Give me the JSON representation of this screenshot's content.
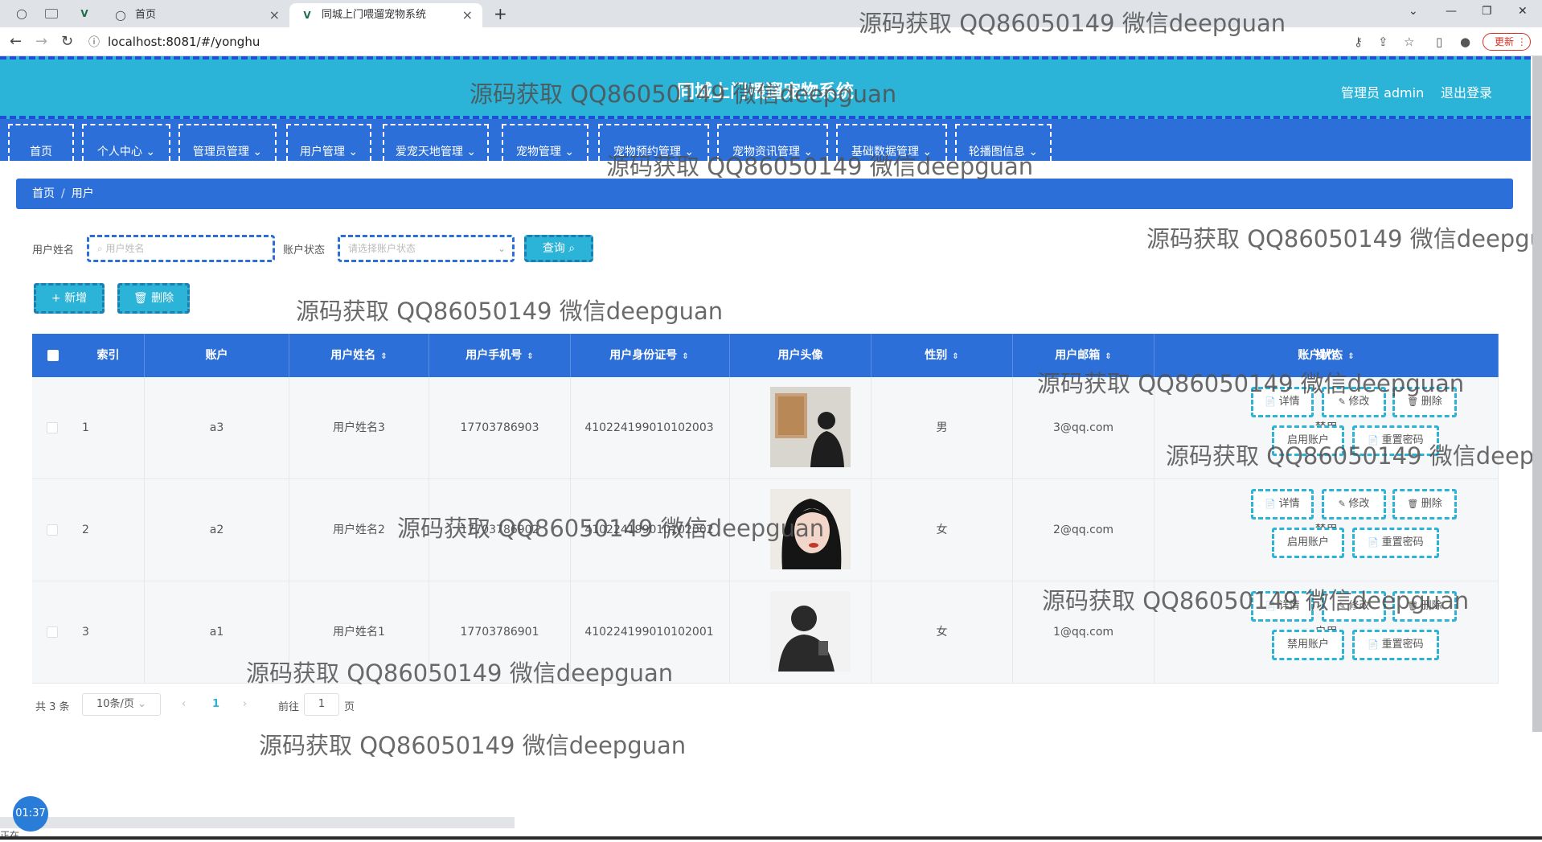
{
  "browser": {
    "tabs": [
      {
        "title": "首页",
        "icon": "globe-icon"
      },
      {
        "title": "同城上门喂遛宠物系统",
        "icon": "vue-icon"
      }
    ],
    "url": "localhost:8081/#/yonghu",
    "update_label": "更新"
  },
  "header": {
    "title": "同城上门喂遛宠物系统",
    "admin_label": "管理员 admin",
    "logout_label": "退出登录"
  },
  "menu": [
    {
      "label": "首页",
      "dropdown": false
    },
    {
      "label": "个人中心",
      "dropdown": true
    },
    {
      "label": "管理员管理",
      "dropdown": true
    },
    {
      "label": "用户管理",
      "dropdown": true
    },
    {
      "label": "爱宠天地管理",
      "dropdown": true
    },
    {
      "label": "宠物管理",
      "dropdown": true
    },
    {
      "label": "宠物预约管理",
      "dropdown": true
    },
    {
      "label": "宠物资讯管理",
      "dropdown": true
    },
    {
      "label": "基础数据管理",
      "dropdown": true
    },
    {
      "label": "轮播图信息",
      "dropdown": true
    }
  ],
  "breadcrumb": {
    "home": "首页",
    "current": "用户"
  },
  "search": {
    "name_label": "用户姓名",
    "name_placeholder": "用户姓名",
    "status_label": "账户状态",
    "status_placeholder": "请选择账户状态",
    "query_label": "查询"
  },
  "actions": {
    "add_label": "+ 新增",
    "delete_label": "删除"
  },
  "table": {
    "columns": [
      "索引",
      "账户",
      "用户姓名",
      "用户手机号",
      "用户身份证号",
      "用户头像",
      "性别",
      "用户邮箱",
      "账户状态",
      "操作"
    ],
    "rows": [
      {
        "index": "1",
        "account": "a3",
        "name": "用户姓名3",
        "phone": "17703786903",
        "id_no": "410224199010102003",
        "gender": "男",
        "email": "3@qq.com",
        "status": "禁用",
        "toggle": "启用账户"
      },
      {
        "index": "2",
        "account": "a2",
        "name": "用户姓名2",
        "phone": "17703786902",
        "id_no": "410224199010102002",
        "gender": "女",
        "email": "2@qq.com",
        "status": "禁用",
        "toggle": "启用账户"
      },
      {
        "index": "3",
        "account": "a1",
        "name": "用户姓名1",
        "phone": "17703786901",
        "id_no": "410224199010102001",
        "gender": "女",
        "email": "1@qq.com",
        "status": "启用",
        "toggle": "禁用账户"
      }
    ],
    "op_labels": {
      "detail": "详情",
      "edit": "修改",
      "delete": "删除",
      "reset": "重置密码"
    }
  },
  "pagination": {
    "total": "共 3 条",
    "page_size": "10条/页",
    "current": "1",
    "goto_prefix": "前往",
    "goto_value": "1",
    "goto_suffix": "页"
  },
  "overlay": {
    "watermark": "源码获取 QQ86050149 微信deepguan",
    "timer": "01:37",
    "status": "正在..."
  },
  "colors": {
    "header": "#2bb3d8",
    "menu": "#2d6fd8",
    "dashed_accent": "#1e4fd6"
  }
}
